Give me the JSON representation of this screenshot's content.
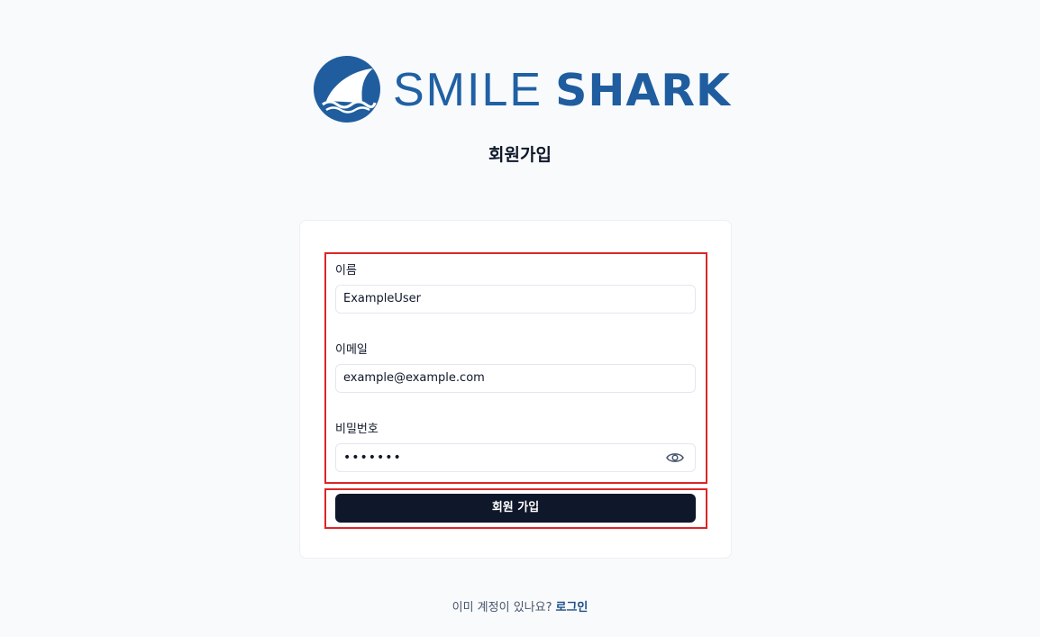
{
  "brand": {
    "name_light": "SMILE",
    "name_bold": "SHARK",
    "logo_icon": "shark-fin-icon",
    "primary_color": "#1e5fa0"
  },
  "page": {
    "title": "회원가입"
  },
  "form": {
    "name": {
      "label": "이름",
      "value": "ExampleUser"
    },
    "email": {
      "label": "이메일",
      "value": "example@example.com"
    },
    "password": {
      "label": "비밀번호",
      "masked_value": "•••••••",
      "toggle_icon": "eye-icon"
    },
    "submit_label": "회원 가입"
  },
  "footer": {
    "prompt": "이미 계정이 있나요?",
    "login_link": "로그인"
  },
  "colors": {
    "highlight": "#dc2626",
    "button_bg": "#0f172a",
    "page_bg": "#f8fafc"
  }
}
